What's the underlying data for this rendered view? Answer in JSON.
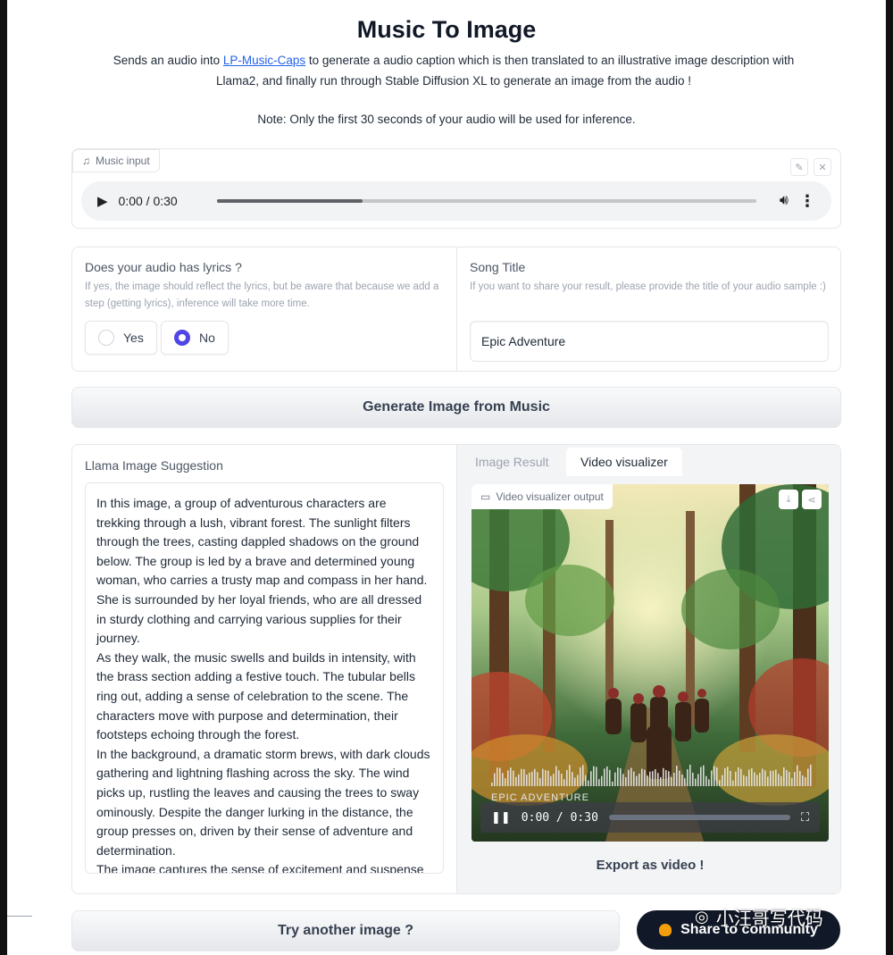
{
  "header": {
    "title": "Music To Image",
    "desc_before": "Sends an audio into ",
    "desc_link": "LP-Music-Caps",
    "desc_after": " to generate a audio caption which is then translated to an illustrative image description with Llama2, and finally run through Stable Diffusion XL to generate an image from the audio !",
    "note": "Note: Only the first 30 seconds of your audio will be used for inference."
  },
  "music_input": {
    "label": "Music input",
    "time": "0:00 / 0:30",
    "progress": 0.27
  },
  "lyrics": {
    "label": "Does your audio has lyrics ?",
    "info": "If yes, the image should reflect the lyrics, but be aware that because we add a step (getting lyrics), inference will take more time.",
    "options": [
      "Yes",
      "No"
    ],
    "selected": "No"
  },
  "song_title": {
    "label": "Song Title",
    "info": "If you want to share your result, please provide the title of your audio sample :)",
    "value": "Epic Adventure"
  },
  "generate_button": "Generate Image from Music",
  "llama": {
    "label": "Llama Image Suggestion",
    "p1": "In this image, a group of adventurous characters are trekking through a lush, vibrant forest. The sunlight filters through the trees, casting dappled shadows on the ground below. The group is led by a brave and determined young woman, who carries a trusty map and compass in her hand. She is surrounded by her loyal friends, who are all dressed in sturdy clothing and carrying various supplies for their journey.",
    "p2": "As they walk, the music swells and builds in intensity, with the brass section adding a festive touch. The tubular bells ring out, adding a sense of celebration to the scene. The characters move with purpose and determination, their footsteps echoing through the forest.",
    "p3": "In the background, a dramatic storm brews, with dark clouds gathering and lightning flashing across the sky. The wind picks up, rustling the leaves and causing the trees to sway ominously. Despite the danger lurking in the distance, the group presses on, driven by their sense of adventure and determination.",
    "p4": "The image captures the sense of excitement and suspense"
  },
  "tabs": {
    "image_result": "Image Result",
    "video_visualizer": "Video visualizer"
  },
  "video": {
    "label": "Video visualizer output",
    "overlay_title": "EPIC ADVENTURE",
    "time": "0:00 / 0:30"
  },
  "export_button": "Export as video !",
  "try_button": "Try another image ?",
  "share_button": "Share to community",
  "watermark": "小汪哥写代码",
  "colors": {
    "accent": "#4f46e5",
    "link": "#2563eb",
    "share_bg": "#111827"
  }
}
